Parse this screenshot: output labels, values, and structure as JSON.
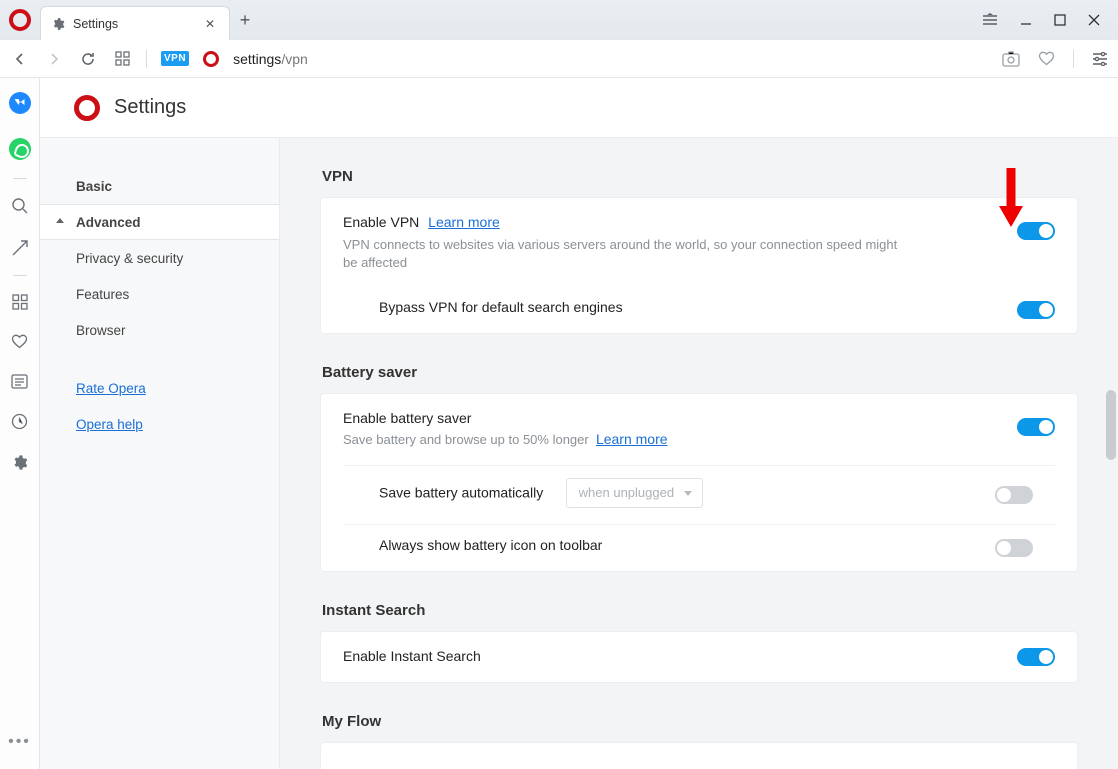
{
  "tab": {
    "title": "Settings"
  },
  "address": {
    "host": "settings",
    "path": "/vpn",
    "vpn_badge": "VPN"
  },
  "page": {
    "title": "Settings"
  },
  "sidebar": {
    "basic": "Basic",
    "advanced": "Advanced",
    "items": [
      "Privacy & security",
      "Features",
      "Browser"
    ],
    "links": {
      "rate": "Rate Opera",
      "help": "Opera help"
    }
  },
  "sections": {
    "vpn": {
      "heading": "VPN",
      "enable": {
        "title": "Enable VPN",
        "learn": "Learn more",
        "sub": "VPN connects to websites via various servers around the world, so your connection speed might be affected",
        "on": true
      },
      "bypass": {
        "title": "Bypass VPN for default search engines",
        "on": true
      }
    },
    "battery": {
      "heading": "Battery saver",
      "enable": {
        "title": "Enable battery saver",
        "sub": "Save battery and browse up to 50% longer",
        "learn": "Learn more",
        "on": true
      },
      "auto": {
        "title": "Save battery automatically",
        "select": "when unplugged",
        "on": false
      },
      "icon": {
        "title": "Always show battery icon on toolbar",
        "on": false
      }
    },
    "instant": {
      "heading": "Instant Search",
      "enable": {
        "title": "Enable Instant Search",
        "on": true
      }
    },
    "flow": {
      "heading": "My Flow"
    }
  }
}
